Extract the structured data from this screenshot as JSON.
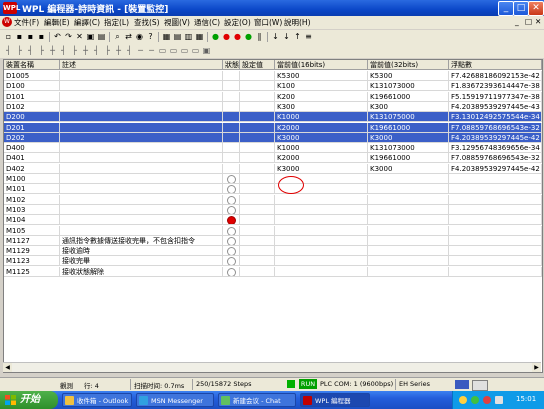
{
  "window": {
    "title": "WPL  編程器-詩時資訊 - [裝置監控]",
    "app_icon": "WPL",
    "minimize_glyph": "_",
    "maximize_glyph": "□",
    "close_glyph": "✕"
  },
  "menu": {
    "doc_icon": "W",
    "items": [
      "文件(F)",
      "編輯(E)",
      "編譯(C)",
      "指定(L)",
      "查找(S)",
      "視圖(V)",
      "通信(C)",
      "設定(O)",
      "窗口(W)",
      "說明(H)"
    ],
    "child_controls": [
      "_",
      "□",
      "✕"
    ]
  },
  "toolbar1": {
    "icons": [
      "new-icon",
      "open-icon",
      "save-icon",
      "print-icon",
      "undo-icon",
      "redo-icon",
      "cut-icon",
      "copy-icon",
      "paste-icon",
      "find-icon",
      "replace-icon",
      "zoom-icon",
      "help-icon",
      "ladder-icon",
      "list-icon",
      "monitor-icon",
      "table-icon",
      "run-icon",
      "stop-icon",
      "red-ball-icon",
      "green-ball-icon",
      "pause-icon",
      "step-icon",
      "download-icon",
      "upload-icon",
      "compare-icon"
    ],
    "glyphs": [
      "▫",
      "▪",
      "▪",
      "▪",
      "↶",
      "↷",
      "✕",
      "▣",
      "▤",
      "⌕",
      "⇄",
      "◉",
      "?",
      "▦",
      "▤",
      "▥",
      "▦",
      "●",
      "●",
      "●",
      "●",
      "∥",
      "↓",
      "↓",
      "↑",
      "≡"
    ]
  },
  "toolbar2": {
    "glyphs": [
      "┤",
      "├",
      "┤",
      "├",
      "┼",
      "┤",
      "├",
      "┼",
      "┤",
      "├",
      "┼",
      "┤",
      "─",
      "─",
      "▭",
      "▭",
      "▭",
      "▭",
      "▣"
    ]
  },
  "table": {
    "columns": [
      "裝置名稱",
      "註述",
      "狀態",
      "設定值",
      "當前值(16bits)",
      "當前值(32bits)",
      "浮點數"
    ],
    "rows": [
      {
        "name": "D1005",
        "note": "",
        "state": "",
        "set": "",
        "v16": "K5300",
        "v32": "K5300",
        "float": "F7.42688186092153e-42",
        "selected": false
      },
      {
        "name": "D100",
        "note": "",
        "state": "",
        "set": "",
        "v16": "K100",
        "v32": "K131073000",
        "float": "F1.83672393614447e-38",
        "selected": false
      },
      {
        "name": "D101",
        "note": "",
        "state": "",
        "set": "",
        "v16": "K200",
        "v32": "K19661000",
        "float": "F5.15919711977347e-38",
        "selected": false
      },
      {
        "name": "D102",
        "note": "",
        "state": "",
        "set": "",
        "v16": "K300",
        "v32": "K300",
        "float": "F4.20389539297445e-43",
        "selected": false
      },
      {
        "name": "D200",
        "note": "",
        "state": "",
        "set": "",
        "v16": "K1000",
        "v32": "K131075000",
        "float": "F3.13012492575544e-34",
        "selected": true
      },
      {
        "name": "D201",
        "note": "",
        "state": "",
        "set": "",
        "v16": "K2000",
        "v32": "K19661000",
        "float": "F7.08859768696543e-32",
        "selected": true
      },
      {
        "name": "D202",
        "note": "",
        "state": "",
        "set": "",
        "v16": "K3000",
        "v32": "K3000",
        "float": "F4.20389539297445e-42",
        "selected": true
      },
      {
        "name": "D400",
        "note": "",
        "state": "",
        "set": "",
        "v16": "K1000",
        "v32": "K131073000",
        "float": "F3.12956748369656e-34",
        "selected": false
      },
      {
        "name": "D401",
        "note": "",
        "state": "",
        "set": "",
        "v16": "K2000",
        "v32": "K19661000",
        "float": "F7.08859768696543e-32",
        "selected": false
      },
      {
        "name": "D402",
        "note": "",
        "state": "",
        "set": "",
        "v16": "K3000",
        "v32": "K3000",
        "float": "F4.20389539297445e-42",
        "selected": false
      },
      {
        "name": "M100",
        "note": "",
        "state": "off",
        "set": "",
        "v16": "",
        "v32": "",
        "float": "",
        "selected": false
      },
      {
        "name": "M101",
        "note": "",
        "state": "off",
        "set": "",
        "v16": "",
        "v32": "",
        "float": "",
        "selected": false
      },
      {
        "name": "M102",
        "note": "",
        "state": "off",
        "set": "",
        "v16": "",
        "v32": "",
        "float": "",
        "selected": false
      },
      {
        "name": "M103",
        "note": "",
        "state": "off",
        "set": "",
        "v16": "",
        "v32": "",
        "float": "",
        "selected": false
      },
      {
        "name": "M104",
        "note": "",
        "state": "on",
        "set": "",
        "v16": "",
        "v32": "",
        "float": "",
        "selected": false
      },
      {
        "name": "M105",
        "note": "",
        "state": "off",
        "set": "",
        "v16": "",
        "v32": "",
        "float": "",
        "selected": false
      },
      {
        "name": "M1127",
        "note": "通訊指令數據傳送接收完畢，不包含扣指令",
        "state": "off",
        "set": "",
        "v16": "",
        "v32": "",
        "float": "",
        "selected": false
      },
      {
        "name": "M1129",
        "note": "接收逾時",
        "state": "off",
        "set": "",
        "v16": "",
        "v32": "",
        "float": "",
        "selected": false
      },
      {
        "name": "M1123",
        "note": "接收完畢",
        "state": "off",
        "set": "",
        "v16": "",
        "v32": "",
        "float": "",
        "selected": false
      },
      {
        "name": "M1125",
        "note": "接收狀態解除",
        "state": "off",
        "set": "",
        "v16": "",
        "v32": "",
        "float": "",
        "selected": false
      }
    ]
  },
  "scroll": {
    "left": "◀",
    "right": "▶"
  },
  "status": {
    "mode": "觀測",
    "line": "行: 4",
    "scan_time": "扫描时间: 0.7ms",
    "steps": "250/15872 Steps",
    "run": "RUN",
    "comm": "PLC COM: 1 (9600bps)",
    "series": "EH Series"
  },
  "taskbar": {
    "start": "开始",
    "tasks": [
      {
        "label": "收件箱 - Outlook",
        "active": false,
        "color": "#f0c040"
      },
      {
        "label": "MSN Messenger",
        "active": false,
        "color": "#30a0e0"
      },
      {
        "label": "新建会议 - Chat",
        "active": false,
        "color": "#60c060"
      },
      {
        "label": "WPL  編程器",
        "active": true,
        "color": "#c00000"
      }
    ],
    "clock": "15:01"
  }
}
